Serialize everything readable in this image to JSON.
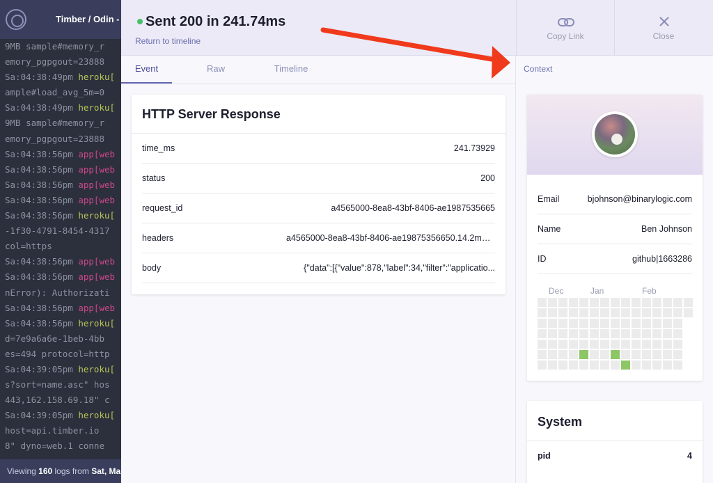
{
  "app": {
    "title": "Timber / Odin - Cl",
    "footer": {
      "prefix": "Viewing ",
      "count": "160",
      "middle": " logs from ",
      "date": "Sat, Ma"
    }
  },
  "logs": [
    {
      "ts": "",
      "src": "",
      "msg": "9MB sample#memory_r"
    },
    {
      "ts": "",
      "src": "",
      "msg": "emory_pgpgout=23888"
    },
    {
      "ts": "Sa:04:38:49pm ",
      "src": "heroku[",
      "kind": "heroku",
      "msg": ""
    },
    {
      "ts": "",
      "src": "",
      "msg": "ample#load_avg_5m=0"
    },
    {
      "ts": "Sa:04:38:49pm ",
      "src": "heroku[",
      "kind": "heroku",
      "msg": ""
    },
    {
      "ts": "",
      "src": "",
      "msg": "9MB sample#memory_r"
    },
    {
      "ts": "",
      "src": "",
      "msg": "emory_pgpgout=23888"
    },
    {
      "ts": "Sa:04:38:56pm ",
      "src": "app[web",
      "kind": "app",
      "msg": ""
    },
    {
      "ts": "Sa:04:38:56pm ",
      "src": "app[web",
      "kind": "app",
      "msg": ""
    },
    {
      "ts": "Sa:04:38:56pm ",
      "src": "app[web",
      "kind": "app",
      "msg": ""
    },
    {
      "ts": "Sa:04:38:56pm ",
      "src": "app[web",
      "kind": "app",
      "msg": ""
    },
    {
      "ts": "Sa:04:38:56pm ",
      "src": "heroku[",
      "kind": "heroku",
      "msg": ""
    },
    {
      "ts": "",
      "src": "",
      "msg": "-1f30-4791-8454-4317"
    },
    {
      "ts": "",
      "src": "",
      "msg": "col=https"
    },
    {
      "ts": "Sa:04:38:56pm ",
      "src": "app[web",
      "kind": "app",
      "msg": ""
    },
    {
      "ts": "Sa:04:38:56pm ",
      "src": "app[web",
      "kind": "app",
      "msg": ""
    },
    {
      "ts": "",
      "src": "",
      "msg": "nError): Authorizati"
    },
    {
      "ts": "Sa:04:38:56pm ",
      "src": "app[web",
      "kind": "app",
      "msg": ""
    },
    {
      "ts": "Sa:04:38:56pm ",
      "src": "heroku[",
      "kind": "heroku",
      "msg": ""
    },
    {
      "ts": "",
      "src": "",
      "msg": "d=7e9a6a6e-1beb-4bb"
    },
    {
      "ts": "",
      "src": "",
      "msg": "es=494 protocol=http"
    },
    {
      "ts": "Sa:04:39:05pm ",
      "src": "heroku[",
      "kind": "heroku",
      "msg": ""
    },
    {
      "ts": "",
      "src": "",
      "msg": "s?sort=name.asc\" hos"
    },
    {
      "ts": "",
      "src": "",
      "msg": "443,162.158.69.18\" c"
    },
    {
      "ts": "Sa:04:39:05pm ",
      "src": "heroku[",
      "kind": "heroku",
      "msg": ""
    },
    {
      "ts": "",
      "src": "",
      "msg": "host=api.timber.io"
    },
    {
      "ts": "",
      "src": "",
      "msg": "8\" dyno=web.1 conne"
    }
  ],
  "panel": {
    "title": "Sent 200 in 241.74ms",
    "return_link": "Return to timeline",
    "copy_link": "Copy Link",
    "close": "Close",
    "tabs": [
      "Event",
      "Raw",
      "Timeline"
    ],
    "context_label": "Context"
  },
  "http_card": {
    "title": "HTTP Server Response",
    "rows": [
      {
        "key": "time_ms",
        "value": "241.73929"
      },
      {
        "key": "status",
        "value": "200"
      },
      {
        "key": "request_id",
        "value": "a4565000-8ea8-43bf-8406-ae1987535665"
      },
      {
        "key": "headers",
        "value": "a4565000-8ea8-43bf-8406-ae19875356650.14.2max..."
      },
      {
        "key": "body",
        "value": "{\"data\":[{\"value\":878,\"label\":34,\"filter\":\"applicatio..."
      }
    ]
  },
  "user_card": {
    "rows": [
      {
        "key": "Email",
        "value": "bjohnson@binarylogic.com"
      },
      {
        "key": "Name",
        "value": "Ben Johnson"
      },
      {
        "key": "ID",
        "value": "github|1663286"
      }
    ],
    "calendar": {
      "months": [
        "Dec",
        "Jan",
        "Feb"
      ],
      "active_cells": [
        [
          4,
          5
        ],
        [
          7,
          5
        ],
        [
          8,
          6
        ]
      ],
      "cols": 15,
      "rows": 7,
      "active_color": "#8cc665",
      "empty_color": "#ebebeb"
    }
  },
  "system_card": {
    "title": "System",
    "rows": [
      {
        "key": "pid",
        "value": "4"
      }
    ]
  },
  "annotation": {
    "arrow_color": "#f03a1c"
  },
  "icons": [
    "link-icon",
    "close-icon",
    "timber-logo-icon",
    "status-dot-icon"
  ]
}
